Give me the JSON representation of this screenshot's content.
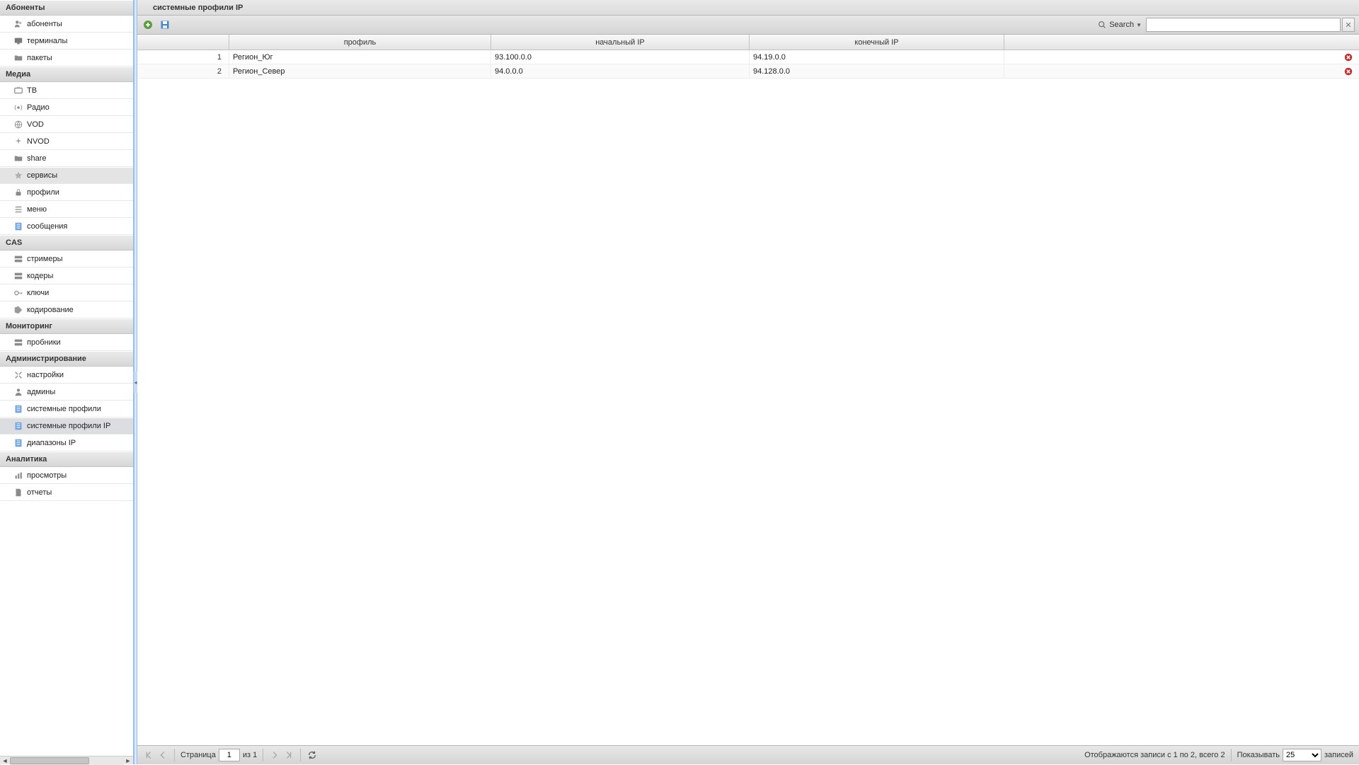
{
  "sidebar": {
    "groups": [
      {
        "title": "Абоненты",
        "items": [
          {
            "label": "абоненты",
            "icon": "users"
          },
          {
            "label": "терминалы",
            "icon": "monitor"
          },
          {
            "label": "пакеты",
            "icon": "folder"
          }
        ]
      },
      {
        "title": "Медиа",
        "items": [
          {
            "label": "ТВ",
            "icon": "tv"
          },
          {
            "label": "Радио",
            "icon": "radio"
          },
          {
            "label": "VOD",
            "icon": "globe"
          },
          {
            "label": "NVOD",
            "icon": "sparkle"
          },
          {
            "label": "share",
            "icon": "folder"
          },
          {
            "label": "сервисы",
            "icon": "star",
            "hover": true
          },
          {
            "label": "профили",
            "icon": "lock"
          },
          {
            "label": "меню",
            "icon": "list"
          },
          {
            "label": "сообщения",
            "icon": "form"
          }
        ]
      },
      {
        "title": "CAS",
        "items": [
          {
            "label": "стримеры",
            "icon": "server"
          },
          {
            "label": "кодеры",
            "icon": "server"
          },
          {
            "label": "ключи",
            "icon": "key"
          },
          {
            "label": "кодирование",
            "icon": "tag"
          }
        ]
      },
      {
        "title": "Мониторинг",
        "items": [
          {
            "label": "пробники",
            "icon": "server"
          }
        ]
      },
      {
        "title": "Администрирование",
        "items": [
          {
            "label": "настройки",
            "icon": "tools"
          },
          {
            "label": "админы",
            "icon": "user"
          },
          {
            "label": "системные профили",
            "icon": "form"
          },
          {
            "label": "системные профили IP",
            "icon": "form",
            "selected": true
          },
          {
            "label": "диапазоны IP",
            "icon": "form"
          }
        ]
      },
      {
        "title": "Аналитика",
        "items": [
          {
            "label": "просмотры",
            "icon": "chart"
          },
          {
            "label": "отчеты",
            "icon": "doc"
          }
        ]
      }
    ]
  },
  "header": {
    "title": "системные профили IP"
  },
  "toolbar": {
    "search_label": "Search",
    "search_value": ""
  },
  "grid": {
    "columns": {
      "profile": "профиль",
      "ip_start": "начальный IP",
      "ip_end": "конечный IP"
    },
    "rows": [
      {
        "n": "1",
        "profile": "Регион_Юг",
        "ip_start": "93.100.0.0",
        "ip_end": "94.19.0.0"
      },
      {
        "n": "2",
        "profile": "Регион_Север",
        "ip_start": "94.0.0.0",
        "ip_end": "94.128.0.0"
      }
    ]
  },
  "footer": {
    "page_label": "Страница",
    "page_value": "1",
    "of_label": "из 1",
    "status": "Отображаются записи с 1 по 2, всего 2",
    "show_label": "Показывать",
    "show_value": "25",
    "records_label": "записей"
  }
}
